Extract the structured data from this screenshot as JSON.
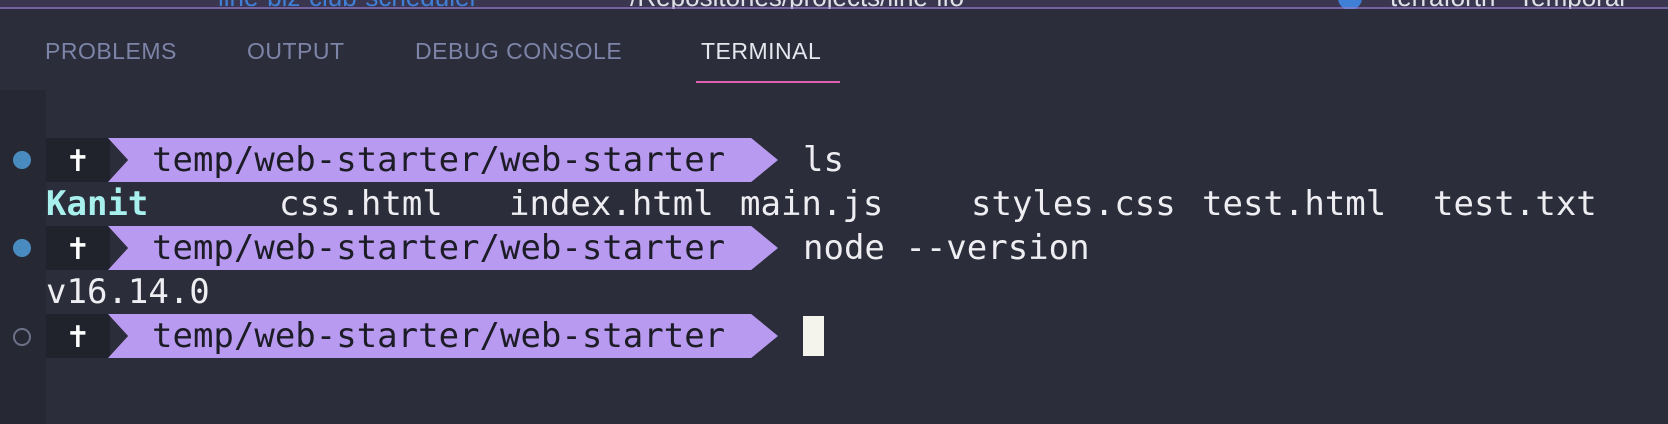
{
  "top_strip": {
    "project": "line-biz-club-scheduler",
    "path": "~/Repositories/projects/line-lfo",
    "right_text": "terraforth - Temporal"
  },
  "panel": {
    "tabs": [
      {
        "label": "PROBLEMS",
        "active": false
      },
      {
        "label": "OUTPUT",
        "active": false
      },
      {
        "label": "DEBUG CONSOLE",
        "active": false
      },
      {
        "label": "TERMINAL",
        "active": true
      }
    ],
    "accent": "#e060b0"
  },
  "terminal": {
    "prompt_user_symbol": "✝",
    "prompt_path": "temp/web-starter/web-starter",
    "prompt_color": "#b89af0",
    "commands": [
      {
        "command": "ls",
        "status": "done"
      },
      {
        "command": "node --version",
        "status": "done"
      },
      {
        "command": "",
        "status": "pending"
      }
    ],
    "ls_output": [
      "Kanit",
      "css.html",
      "index.html",
      "main.js",
      "styles.css",
      "test.html",
      "test.txt"
    ],
    "node_output": "v16.14.0"
  }
}
